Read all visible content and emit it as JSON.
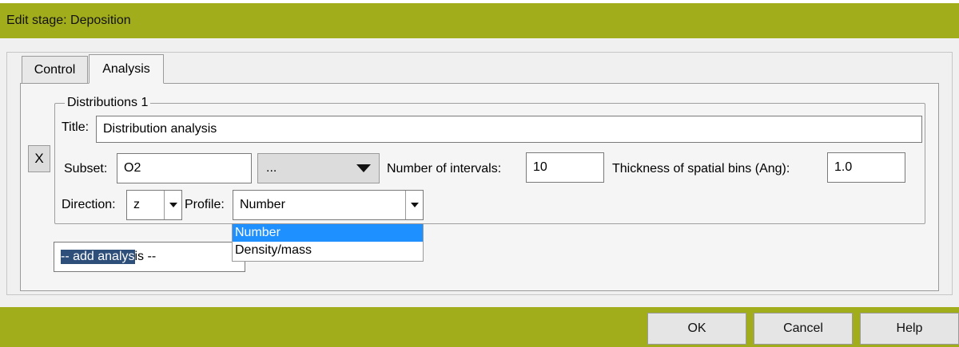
{
  "window": {
    "title": "Edit stage: Deposition"
  },
  "tabs": [
    {
      "label": "Control"
    },
    {
      "label": "Analysis"
    }
  ],
  "distributions": {
    "group_title": "Distributions 1",
    "remove_label": "X",
    "title_label": "Title:",
    "title_value": "Distribution analysis",
    "subset_label": "Subset:",
    "subset_value": "O2",
    "subset_picker_label": "...",
    "intervals_label": "Number of intervals:",
    "intervals_value": "10",
    "thickness_label": "Thickness of spatial bins (Ang):",
    "thickness_value": "1.0",
    "direction_label": "Direction:",
    "direction_value": "z",
    "profile_label": "Profile:",
    "profile_value": "Number",
    "profile_options": [
      "Number",
      "Density/mass"
    ]
  },
  "add_analysis": {
    "selected_part": "-- add analys",
    "rest_part": "is --"
  },
  "footer": {
    "ok_label": "OK",
    "cancel_label": "Cancel",
    "help_label": "Help"
  },
  "colors": {
    "titlebar": "#a2ad1c",
    "selection": "#1e90ff"
  }
}
